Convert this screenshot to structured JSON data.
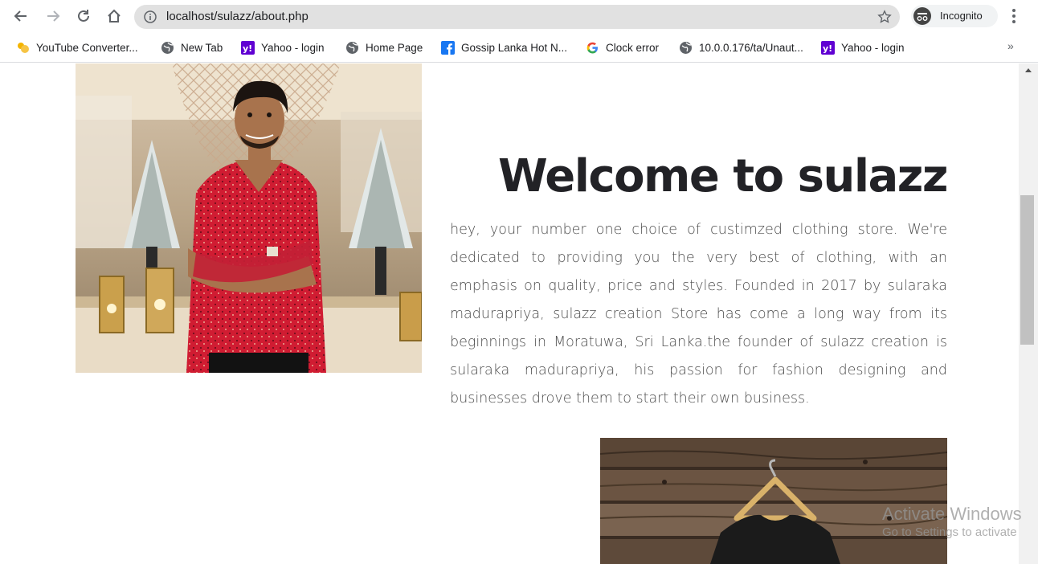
{
  "browser": {
    "url": "localhost/sulazz/about.php",
    "incognito_label": "Incognito",
    "bookmarks": [
      {
        "label": "YouTube Converter...",
        "icon": "folder-icon"
      },
      {
        "label": "New Tab",
        "icon": "globe-icon"
      },
      {
        "label": "Yahoo - login",
        "icon": "yahoo-icon"
      },
      {
        "label": "Home Page",
        "icon": "globe-icon"
      },
      {
        "label": "Gossip Lanka Hot N...",
        "icon": "facebook-icon"
      },
      {
        "label": "Clock error",
        "icon": "google-icon"
      },
      {
        "label": "10.0.0.176/ta/Unaut...",
        "icon": "globe-icon"
      },
      {
        "label": "Yahoo - login",
        "icon": "yahoo-icon"
      }
    ],
    "more_bookmarks": "»"
  },
  "page": {
    "heading": "Welcome to sulazz",
    "paragraph": "hey, your number one choice of custimzed clothing store. We're dedicated to providing you the very best of clothing, with an emphasis on quality, price and styles. Founded in 2017 by sularaka madurapriya, sulazz creation Store has come a long way from its beginnings in Moratuwa, Sri Lanka.the founder of sulazz creation is sularaka madurapriya, his passion for fashion designing and businesses drove them to start their own business."
  },
  "watermark": {
    "title": "Activate Windows",
    "subtitle": "Go to Settings to activate"
  },
  "colors": {
    "heading": "#222226",
    "body_text": "#4d4d4d",
    "omnibox": "#e1e1e1",
    "shirt_red": "#d01c32"
  }
}
